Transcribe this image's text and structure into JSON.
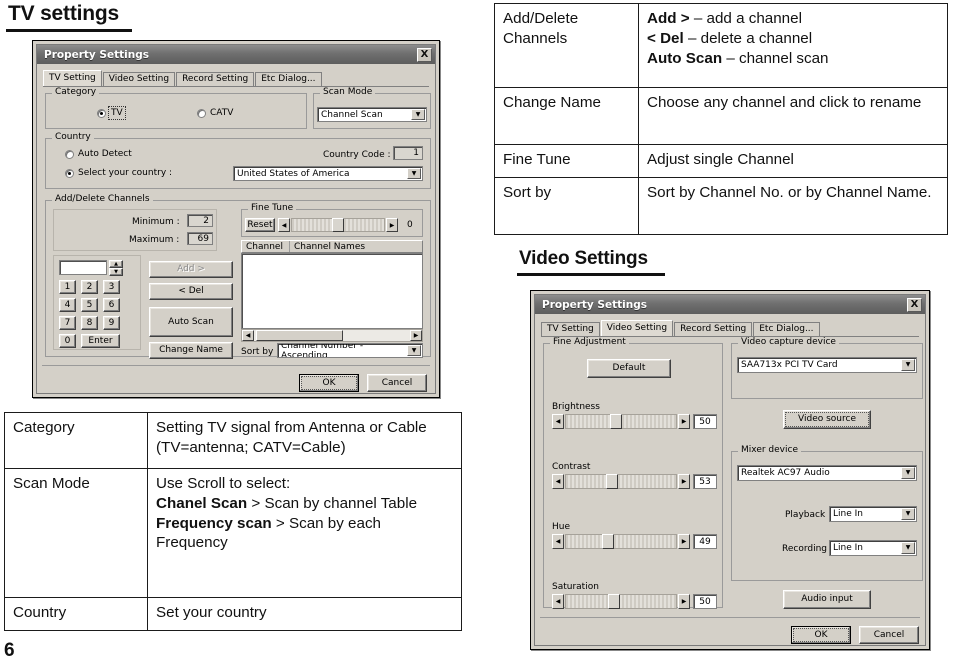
{
  "page": {
    "number": "6"
  },
  "sections": {
    "tv": {
      "title": "TV settings"
    },
    "video": {
      "title": "Video Settings"
    }
  },
  "tv_dialog": {
    "title": "Property Settings",
    "close_label": "X",
    "tabs": [
      {
        "label": "TV Setting",
        "active": true
      },
      {
        "label": "Video Setting",
        "active": false
      },
      {
        "label": "Record Setting",
        "active": false
      },
      {
        "label": "Etc Dialog...",
        "active": false
      }
    ],
    "category": {
      "legend": "Category",
      "tv_label": "TV",
      "catv_label": "CATV"
    },
    "scan_mode": {
      "legend": "Scan Mode",
      "value": "Channel Scan"
    },
    "country": {
      "legend": "Country",
      "auto_detect_label": "Auto Detect",
      "select_label": "Select your country :",
      "value": "United States of America",
      "code_label": "Country Code :",
      "code_value": "1"
    },
    "add_delete": {
      "legend": "Add/Delete Channels",
      "minimum_label": "Minimum :",
      "minimum_value": "2",
      "maximum_label": "Maximum :",
      "maximum_value": "69",
      "spin_value": "",
      "keys": [
        "1",
        "2",
        "3",
        "4",
        "5",
        "6",
        "7",
        "8",
        "9",
        "0"
      ],
      "enter_label": "Enter",
      "add_label": "Add >",
      "del_label": "< Del",
      "auto_scan_label": "Auto Scan",
      "change_name_label": "Change Name"
    },
    "fine_tune": {
      "legend": "Fine Tune",
      "reset_label": "Reset",
      "value": "0"
    },
    "channel_list": {
      "col_channel": "Channel",
      "col_names": "Channel Names",
      "rows": []
    },
    "sort_by": {
      "label": "Sort by :",
      "value": "Channel Number - Ascending"
    },
    "ok_label": "OK",
    "cancel_label": "Cancel"
  },
  "video_dialog": {
    "title": "Property Settings",
    "close_label": "X",
    "tabs": [
      {
        "label": "TV Setting",
        "active": false
      },
      {
        "label": "Video Setting",
        "active": true
      },
      {
        "label": "Record Setting",
        "active": false
      },
      {
        "label": "Etc Dialog...",
        "active": false
      }
    ],
    "fine_adjustment": {
      "legend": "Fine Adjustment",
      "default_label": "Default",
      "sliders": [
        {
          "label": "Brightness",
          "value": "50",
          "pos": 46
        },
        {
          "label": "Contrast",
          "value": "53",
          "pos": 42
        },
        {
          "label": "Hue",
          "value": "49",
          "pos": 39
        },
        {
          "label": "Saturation",
          "value": "50",
          "pos": 44
        }
      ]
    },
    "video_capture": {
      "legend": "Video capture device",
      "value": "SAA713x PCI TV Card",
      "video_source_label": "Video source"
    },
    "mixer": {
      "legend": "Mixer device",
      "value": "Realtek AC97 Audio",
      "playback_label": "Playback :",
      "playback_value": "Line In",
      "recording_label": "Recording :",
      "recording_value": "Line In",
      "audio_input_label": "Audio input"
    },
    "ok_label": "OK",
    "cancel_label": "Cancel"
  },
  "table_right": {
    "rows": [
      {
        "key": "Add/Delete Channels",
        "lines": [
          {
            "bold": "Add >",
            "rest": " – add a channel"
          },
          {
            "bold": "< Del",
            "rest": " – delete a channel"
          },
          {
            "bold": "Auto Scan",
            "rest": " – channel scan"
          }
        ]
      },
      {
        "key": "Change Name",
        "lines": [
          {
            "bold": "",
            "rest": "Choose any channel and click to rename"
          }
        ]
      },
      {
        "key": "Fine Tune",
        "lines": [
          {
            "bold": "",
            "rest": "Adjust single Channel"
          }
        ]
      },
      {
        "key": "Sort by",
        "lines": [
          {
            "bold": "",
            "rest": "Sort by Channel No. or by Channel Name."
          }
        ]
      }
    ]
  },
  "table_left": {
    "rows": [
      {
        "key": "Category",
        "lines": [
          {
            "bold": "",
            "rest": "Setting TV signal from Antenna or Cable (TV=antenna; CATV=Cable)"
          }
        ]
      },
      {
        "key": "Scan Mode",
        "lines": [
          {
            "bold": "",
            "rest": "Use Scroll to select:"
          },
          {
            "bold": "Chanel Scan",
            "rest": " > Scan by channel Table"
          },
          {
            "bold": "Frequency scan",
            "rest": " > Scan by each Frequency"
          }
        ]
      },
      {
        "key": "Country",
        "lines": [
          {
            "bold": "",
            "rest": "Set your country"
          }
        ]
      }
    ]
  }
}
